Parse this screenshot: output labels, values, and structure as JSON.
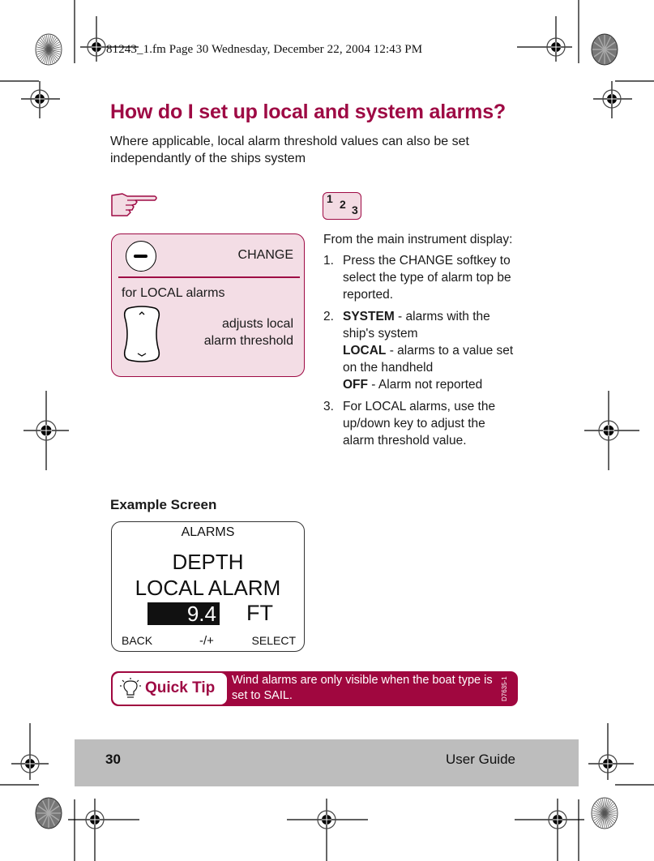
{
  "print_header": {
    "stamp": "81243_1.fm  Page 30  Wednesday, December 22, 2004  12:43 PM"
  },
  "page": {
    "title": "How do I set up local and system alarms?",
    "subtitle": "Where applicable, local alarm threshold values can also be set independantly of the ships system"
  },
  "icons": {
    "hand": "pointing-hand-icon",
    "steps": "steps-123-icon",
    "steps_digits": [
      "1",
      "2",
      "3"
    ],
    "minus_key": "minus-softkey-icon",
    "updown_key": "up-down-key-icon",
    "bulb": "lightbulb-icon",
    "registration": "registration-mark-icon",
    "color_target": "color-calibration-target-icon"
  },
  "keys_panel": {
    "change_label": "CHANGE",
    "section_label": "for LOCAL alarms",
    "adjust_line1": "adjusts local",
    "adjust_line2": "alarm threshold"
  },
  "instructions": {
    "intro": "From the main instrument display:",
    "steps": [
      {
        "num": "1.",
        "text": "Press the CHANGE softkey to select the type of alarm top be reported."
      },
      {
        "num": "2.",
        "options": [
          {
            "key": "SYSTEM",
            "desc": " - alarms with the ship's system"
          },
          {
            "key": "LOCAL",
            "desc": " - alarms to a value set on the handheld"
          },
          {
            "key": "OFF",
            "desc": " - Alarm not reported"
          }
        ]
      },
      {
        "num": "3.",
        "text": "For LOCAL alarms, use the up/down key to adjust the alarm threshold value."
      }
    ]
  },
  "example": {
    "heading": "Example Screen",
    "screen": {
      "title": "ALARMS",
      "line1": "DEPTH",
      "line2": "LOCAL ALARM",
      "value": "9.4",
      "unit": "FT",
      "softkey_left": "BACK",
      "softkey_mid": "-/+",
      "softkey_right": "SELECT"
    }
  },
  "quick_tip": {
    "label": "Quick Tip",
    "text": "Wind alarms are only visible when the boat type is set to SAIL.",
    "figure_code": "D7635-1"
  },
  "footer": {
    "page_number": "30",
    "guide_label": "User Guide"
  },
  "colors": {
    "brand": "#9e0a44",
    "panel_pink": "#f3dde5",
    "tip_bar": "#a0073f",
    "footer_gray": "#bdbdbd"
  }
}
